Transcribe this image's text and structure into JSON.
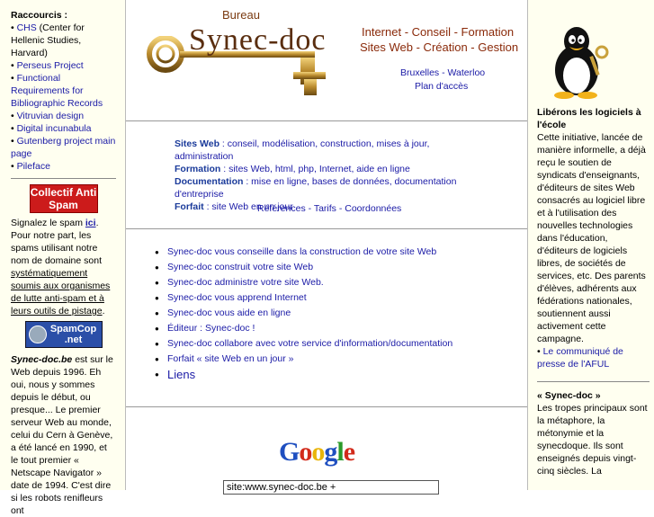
{
  "left": {
    "heading": "Raccourcis :",
    "links": [
      {
        "label": "CHS",
        "suffix": " (Center for Hellenic Studies, Harvard)"
      },
      {
        "label": "Perseus Project"
      },
      {
        "label": "Functional Requirements for Bibliographic Records"
      },
      {
        "label": "Vitruvian design"
      },
      {
        "label": "Digital incunabula"
      },
      {
        "label": "Gutenberg project main page"
      },
      {
        "label": "Pileface"
      }
    ],
    "antispam_badge": "Collectif Anti Spam",
    "spam_text_pre": "Signalez le spam ",
    "spam_link": "ici",
    "spam_text_mid": ". Pour notre part, les spams utilisant notre nom de domaine sont ",
    "spam_text_underlined": "systématiquement soumis aux organismes de lutte anti-spam et à leurs outils de pistage",
    "spam_text_end": ".",
    "spamcop_badge": "SpamCop .net",
    "about_bold": "Synec-doc.be",
    "about_text": " est sur le Web depuis 1996. Eh oui, nous y sommes depuis le début, ou presque... Le premier serveur Web au monde, celui du Cern à Genève, a été lancé en 1990, et le tout premier « Netscape Navigator » date de 1994. C'est dire si les robots renifleurs ont"
  },
  "header": {
    "bureau": "Bureau",
    "brand": "Synec-doc",
    "tagline1": "Internet - Conseil - Formation",
    "tagline2": "Sites Web - Création - Gestion",
    "loc": "Bruxelles - Waterloo",
    "plan": "Plan d'accès"
  },
  "info": {
    "sites_label": "Sites Web",
    "sites_text": " : conseil, modélisation, construction, mises à jour, administration",
    "formation_label": "Formation",
    "formation_text": " : sites Web, html, php, Internet, aide en ligne",
    "doc_label": "Documentation",
    "doc_text": " : mise en ligne, bases de données, documentation d'entreprise",
    "forfait_label": "Forfait",
    "forfait_text": " : site Web en un jour",
    "links": "Références - Tarifs - Coordonnées"
  },
  "bullets": [
    "Synec-doc vous conseille dans la construction de votre site Web",
    "Synec-doc construit votre site Web",
    "Synec-doc administre votre site Web.",
    "Synec-doc vous apprend Internet",
    "Synec-doc vous aide en ligne",
    "Éditeur : Synec-doc !",
    "Synec-doc collabore avec votre service d'information/documentation",
    "Forfait « site Web en un jour »",
    "Liens"
  ],
  "search": {
    "logo": "Google",
    "value": "site:www.synec-doc.be +"
  },
  "right": {
    "heading": "Libérons les logiciels à l'école",
    "text": "Cette initiative, lancée de manière informelle, a déjà reçu le soutien de syndicats d'enseignants, d'éditeurs de sites Web consacrés au logiciel libre et à l'utilisation des nouvelles technologies dans l'éducation, d'éditeurs de logiciels libres, de sociétés de services, etc. Des parents d'élèves, adhérents aux fédérations nationales, soutiennent aussi activement cette campagne.",
    "link": "Le communiqué de presse de l'AFUL",
    "heading2": "« Synec-doc »",
    "text2": "Les tropes principaux sont la métaphore, la métonymie et la synecdoque. Ils sont enseignés depuis vingt-cinq siècles. La"
  }
}
